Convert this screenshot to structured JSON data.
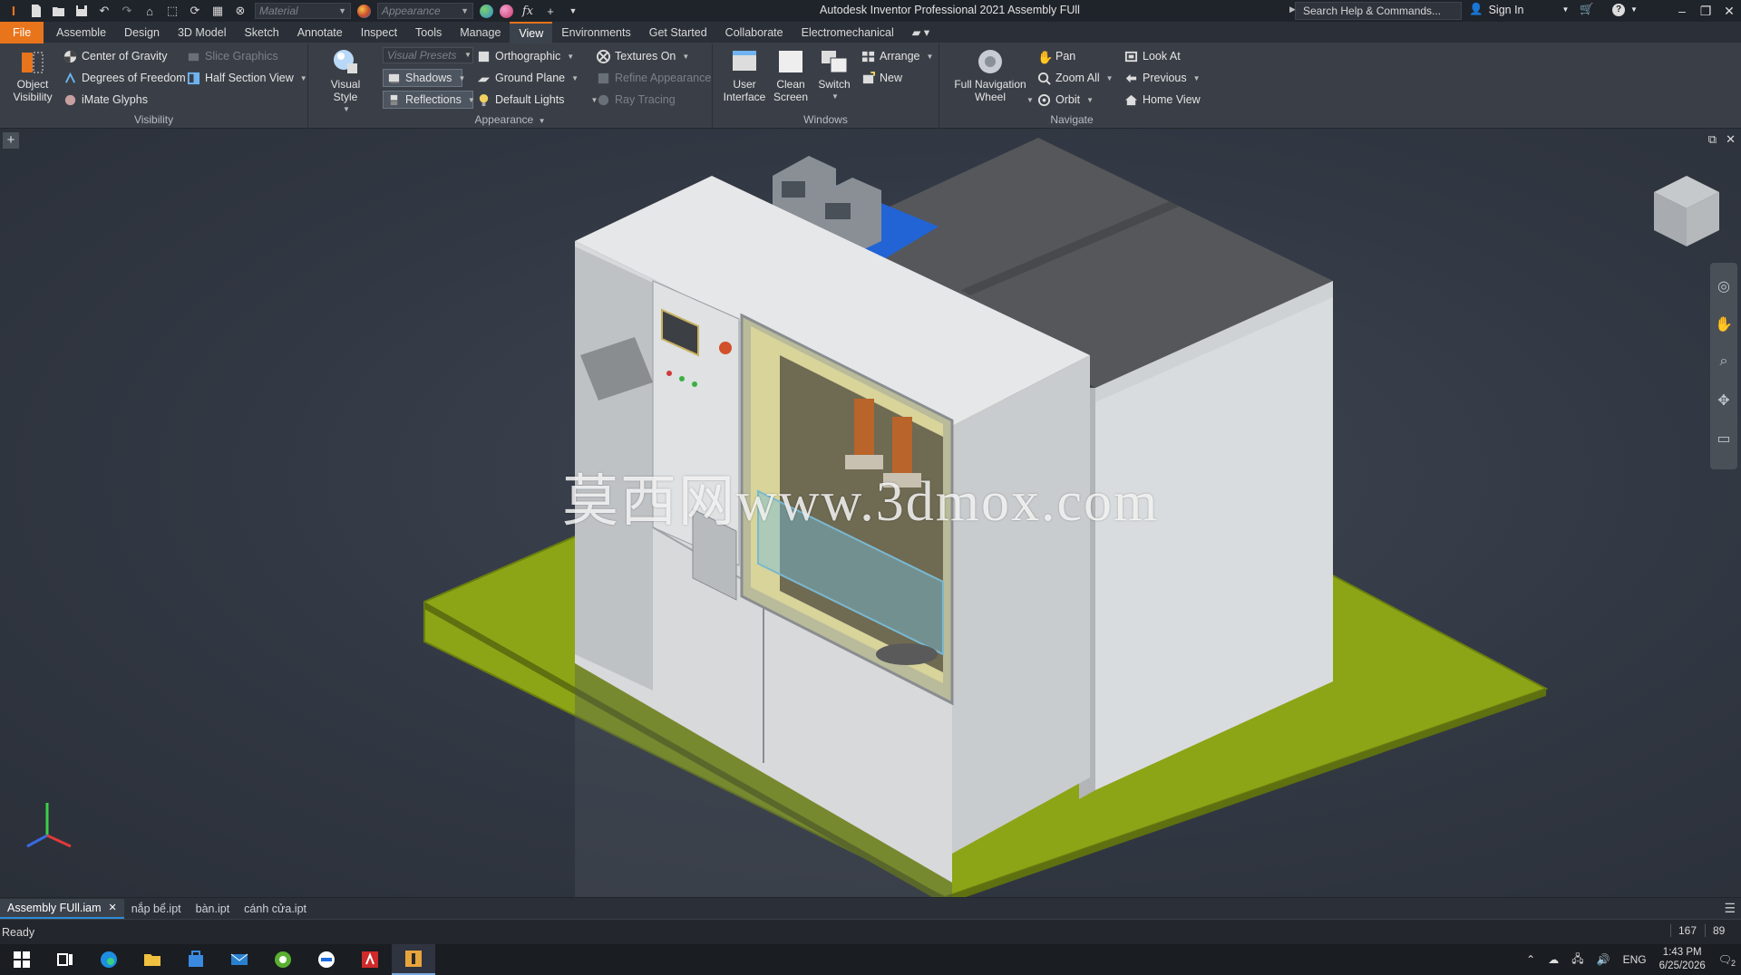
{
  "titlebar": {
    "app_title": "Autodesk Inventor Professional 2021   Assembly FUll",
    "material_placeholder": "Material",
    "appearance_placeholder": "Appearance",
    "search_text": "Search Help & Commands...",
    "sign_in": "Sign In"
  },
  "tabs": [
    "File",
    "Assemble",
    "Design",
    "3D Model",
    "Sketch",
    "Annotate",
    "Inspect",
    "Tools",
    "Manage",
    "View",
    "Environments",
    "Get Started",
    "Collaborate",
    "Electromechanical"
  ],
  "ribbon": {
    "visibility": {
      "title": "Visibility",
      "object_visibility": "Object\nVisibility",
      "center_of_gravity": "Center of Gravity",
      "degrees_of_freedom": "Degrees of Freedom",
      "imate_glyphs": "iMate Glyphs",
      "slice_graphics": "Slice Graphics",
      "half_section_view": "Half Section View"
    },
    "appearance": {
      "title": "Appearance",
      "visual_style": "Visual Style",
      "visual_presets": "Visual Presets",
      "shadows": "Shadows",
      "reflections": "Reflections",
      "orthographic": "Orthographic",
      "ground_plane": "Ground Plane",
      "default_lights": "Default Lights",
      "textures_on": "Textures On",
      "refine_appearance": "Refine Appearance",
      "ray_tracing": "Ray Tracing"
    },
    "windows": {
      "title": "Windows",
      "user_interface": "User\nInterface",
      "clean_screen": "Clean\nScreen",
      "switch": "Switch",
      "arrange": "Arrange",
      "new": "New"
    },
    "navigate": {
      "title": "Navigate",
      "full_navigation_wheel": "Full Navigation\nWheel",
      "pan": "Pan",
      "zoom_all": "Zoom All",
      "orbit": "Orbit",
      "look_at": "Look At",
      "previous": "Previous",
      "home_view": "Home View"
    }
  },
  "viewport": {
    "watermark": "莫西网www.3dmox.com"
  },
  "doc_tabs": [
    "Assembly FUll.iam",
    "nắp bể.ipt",
    "bàn.ipt",
    "cánh cửa.ipt"
  ],
  "status": {
    "text": "Ready",
    "count_a": "167",
    "count_b": "89"
  },
  "tray": {
    "language": "ENG",
    "time": "1:43 PM",
    "date": "6/25/2026",
    "notifications": "2"
  }
}
